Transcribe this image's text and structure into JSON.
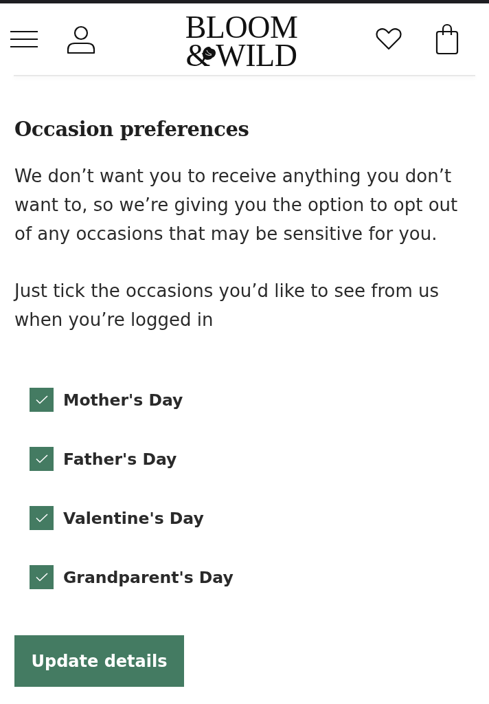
{
  "header": {
    "logo": {
      "line_1": "BLOOM",
      "ampersand": "&",
      "line_2": "WILD"
    }
  },
  "section": {
    "title": "Occasion preferences",
    "paragraphs": [
      "We don’t want you to receive anything you don’t want to, so we’re giving you the option to opt out of any occasions that may be sensitive for you.",
      "Just tick the occasions you’d like to see from us when you’re logged in"
    ]
  },
  "occasions": [
    {
      "label": "Mother's Day",
      "checked": true
    },
    {
      "label": "Father's Day",
      "checked": true
    },
    {
      "label": "Valentine's Day",
      "checked": true
    },
    {
      "label": "Grandparent's Day",
      "checked": true
    }
  ],
  "button": {
    "label": "Update details"
  }
}
